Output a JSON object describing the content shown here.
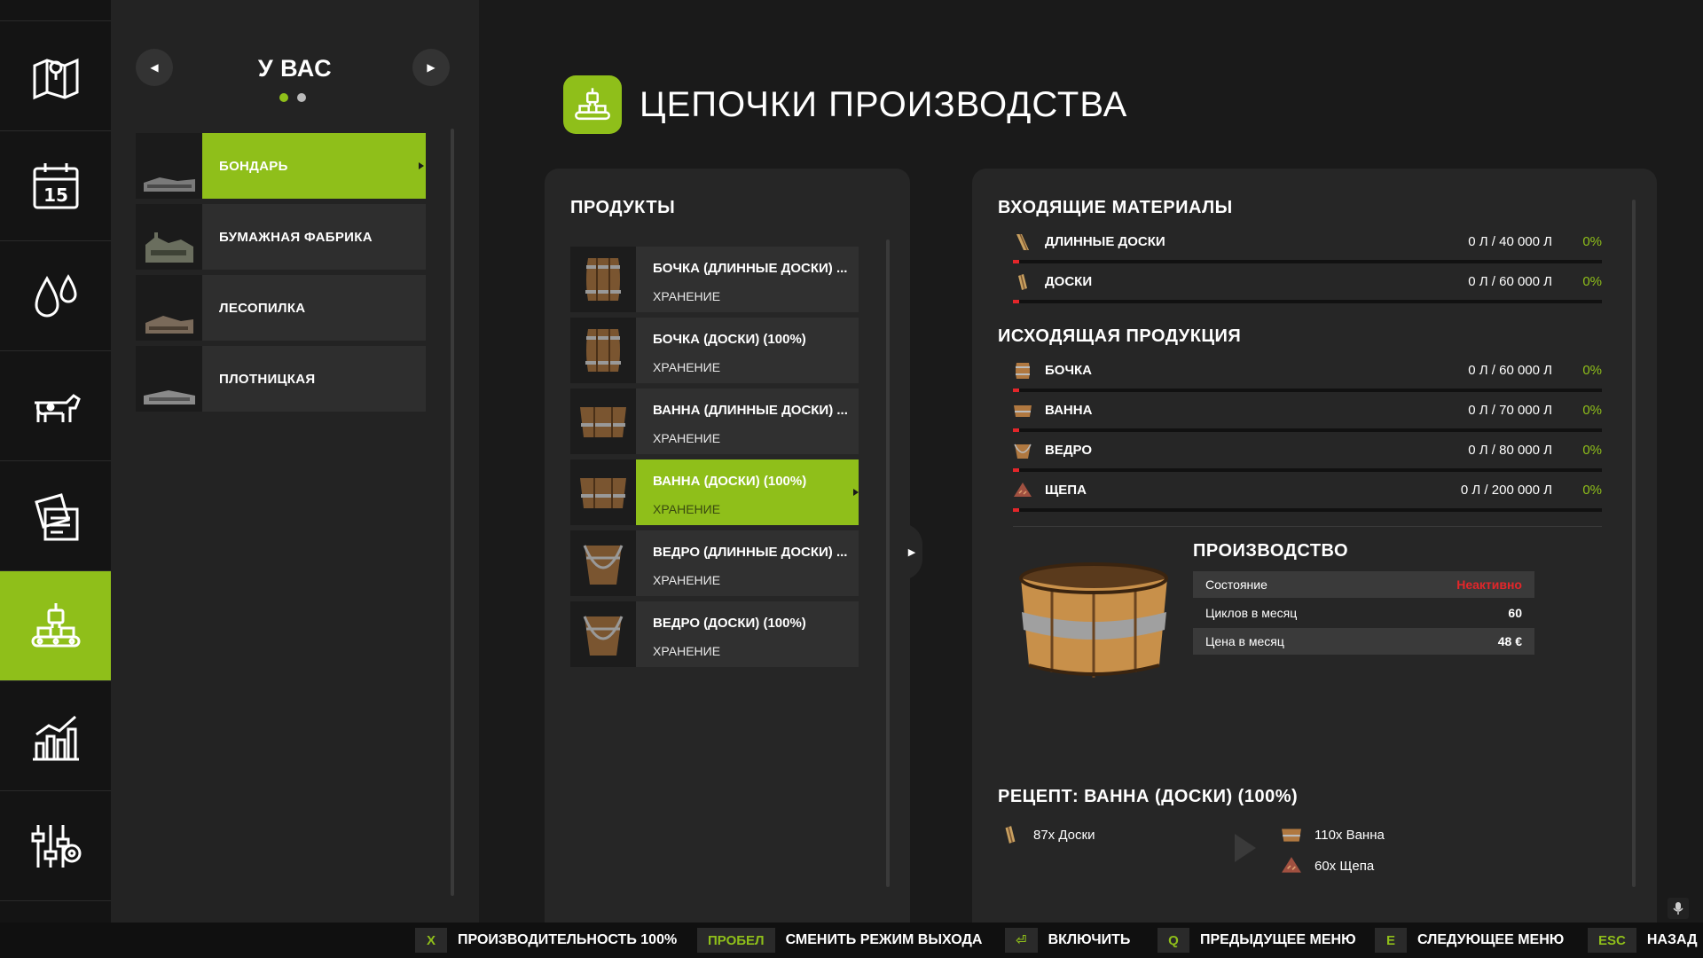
{
  "nav": {
    "items": [
      {
        "icon": "map-icon"
      },
      {
        "icon": "calendar-icon",
        "day": "15"
      },
      {
        "icon": "weather-icon"
      },
      {
        "icon": "animals-icon"
      },
      {
        "icon": "contracts-icon"
      },
      {
        "icon": "production-icon",
        "active": true
      },
      {
        "icon": "statistics-icon"
      },
      {
        "icon": "settings-icon"
      }
    ]
  },
  "facilities": {
    "title": "У ВАС",
    "prev": "◀",
    "next": "▶",
    "items": [
      {
        "label": "БОНДАРЬ",
        "active": true
      },
      {
        "label": "БУМАЖНАЯ ФАБРИКА"
      },
      {
        "label": "ЛЕСОПИЛКА"
      },
      {
        "label": "ПЛОТНИЦКАЯ"
      }
    ]
  },
  "page": {
    "title": "ЦЕПОЧКИ ПРОИЗВОДСТВА"
  },
  "products": {
    "heading": "ПРОДУКТЫ",
    "items": [
      {
        "name": "БОЧКА (ДЛИННЫЕ ДОСКИ) ...",
        "mode": "ХРАНЕНИЕ"
      },
      {
        "name": "БОЧКА (ДОСКИ) (100%)",
        "mode": "ХРАНЕНИЕ"
      },
      {
        "name": "ВАННА (ДЛИННЫЕ ДОСКИ) ...",
        "mode": "ХРАНЕНИЕ"
      },
      {
        "name": "ВАННА (ДОСКИ) (100%)",
        "mode": "ХРАНЕНИЕ",
        "active": true
      },
      {
        "name": "ВЕДРО (ДЛИННЫЕ ДОСКИ) ...",
        "mode": "ХРАНЕНИЕ"
      },
      {
        "name": "ВЕДРО (ДОСКИ) (100%)",
        "mode": "ХРАНЕНИЕ"
      }
    ]
  },
  "inputs": {
    "heading": "ВХОДЯЩИЕ МАТЕРИАЛЫ",
    "items": [
      {
        "name": "ДЛИННЫЕ ДОСКИ",
        "amount": "0 Л / 40 000 Л",
        "percent": "0%"
      },
      {
        "name": "ДОСКИ",
        "amount": "0 Л / 60 000 Л",
        "percent": "0%"
      }
    ]
  },
  "outputs": {
    "heading": "ИСХОДЯЩАЯ ПРОДУКЦИЯ",
    "items": [
      {
        "name": "БОЧКА",
        "amount": "0 Л / 60 000 Л",
        "percent": "0%"
      },
      {
        "name": "ВАННА",
        "amount": "0 Л / 70 000 Л",
        "percent": "0%"
      },
      {
        "name": "ВЕДРО",
        "amount": "0 Л / 80 000 Л",
        "percent": "0%"
      },
      {
        "name": "ЩЕПА",
        "amount": "0 Л / 200 000 Л",
        "percent": "0%"
      }
    ]
  },
  "production": {
    "heading": "ПРОИЗВОДСТВО",
    "rows": [
      {
        "label": "Состояние",
        "value": "Неактивно"
      },
      {
        "label": "Циклов в месяц",
        "value": "60"
      },
      {
        "label": "Цена в месяц",
        "value": "48 €"
      }
    ]
  },
  "recipe": {
    "heading": "РЕЦЕПТ: ВАННА (ДОСКИ) (100%)",
    "input": "87x Доски",
    "outputs": [
      "110x Ванна",
      "60x Щепа"
    ]
  },
  "hints": [
    {
      "key": "X",
      "label": "ПРОИЗВОДИТЕЛЬНОСТЬ 100%"
    },
    {
      "key": "ПРОБЕЛ",
      "label": "СМЕНИТЬ РЕЖИМ ВЫХОДА"
    },
    {
      "key": "⏎",
      "label": "ВКЛЮЧИТЬ"
    },
    {
      "key": "Q",
      "label": "ПРЕДЫДУЩЕЕ МЕНЮ"
    },
    {
      "key": "E",
      "label": "СЛЕДУЮЩЕЕ МЕНЮ"
    },
    {
      "key": "ESC",
      "label": "НАЗАД"
    }
  ],
  "colors": {
    "accent": "#8fbf1a",
    "inactive": "#e3262a",
    "panel": "#262626",
    "background": "#1a1a1a"
  }
}
